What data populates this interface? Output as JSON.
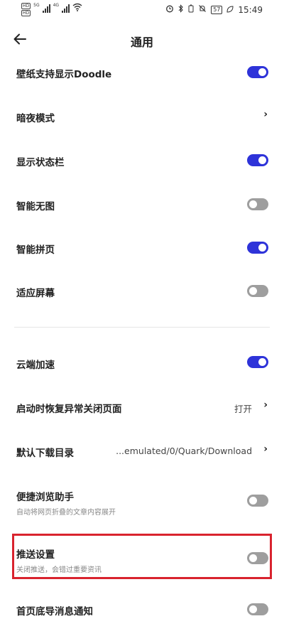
{
  "status_bar": {
    "sim1_badge": "HD",
    "sim1_net": "5G",
    "sim2_badge": "HD",
    "sim2_net": "4G",
    "icons": [
      "wifi-icon",
      "alarm-icon",
      "bluetooth-icon",
      "battery-saver-icon",
      "mute-icon",
      "leaf-icon"
    ],
    "battery": "57",
    "time": "15:49"
  },
  "header": {
    "title": "通用"
  },
  "settings": {
    "wallpaper_doodle": {
      "label": "壁纸支持显示Doodle",
      "on": true
    },
    "dark_mode": {
      "label": "暗夜模式"
    },
    "show_status_bar": {
      "label": "显示状态栏",
      "on": true
    },
    "smart_no_image": {
      "label": "智能无图",
      "on": false
    },
    "smart_page_join": {
      "label": "智能拼页",
      "on": true
    },
    "fit_screen": {
      "label": "适应屏幕",
      "on": false
    },
    "cloud_accel": {
      "label": "云端加速",
      "on": true
    },
    "restore_pages": {
      "label": "启动时恢复异常关闭页面",
      "value": "打开"
    },
    "download_dir": {
      "label": "默认下载目录",
      "value": "...emulated/0/Quark/Download"
    },
    "quick_browse": {
      "label": "便捷浏览助手",
      "sub": "自动将网页折叠的文章内容展开",
      "on": false
    },
    "push_settings": {
      "label": "推送设置",
      "sub": "关闭推送，会错过重要资讯",
      "on": false
    },
    "home_bottom_notify": {
      "label": "首页底导消息通知",
      "on": false
    }
  },
  "colors": {
    "toggle_on": "#2e33d9",
    "toggle_off": "#9e9e9e",
    "highlight": "#d9232e"
  }
}
